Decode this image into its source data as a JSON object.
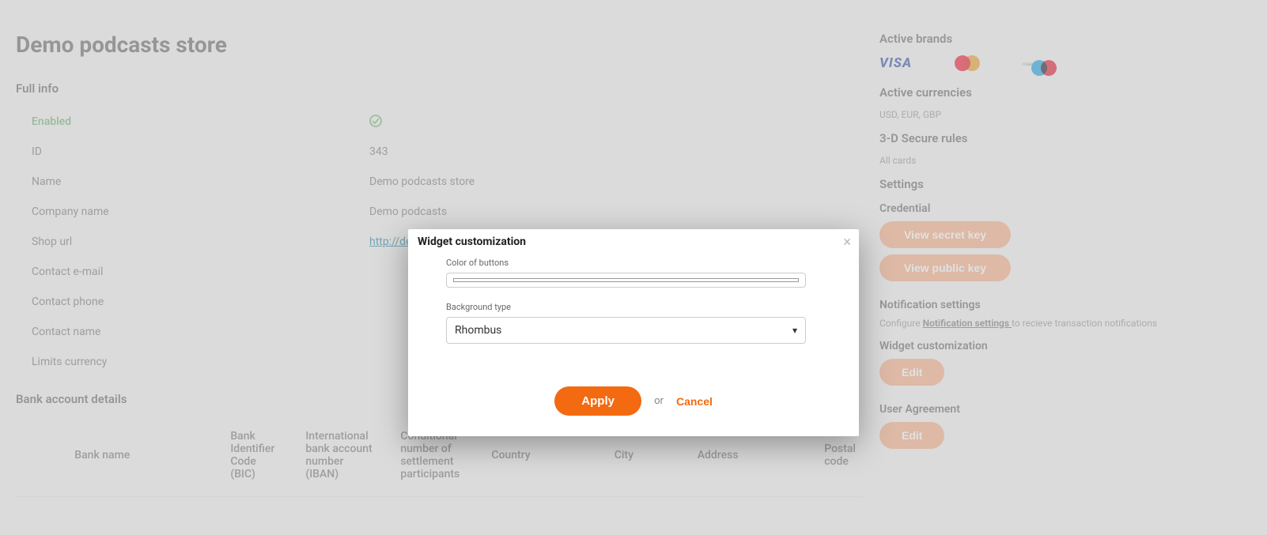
{
  "page_title": "Demo podcasts store",
  "full_info": {
    "heading": "Full info",
    "rows": {
      "enabled": {
        "label": "Enabled"
      },
      "id": {
        "label": "ID",
        "value": "343"
      },
      "name": {
        "label": "Name",
        "value": "Demo podcasts store"
      },
      "company": {
        "label": "Company name",
        "value": "Demo podcasts"
      },
      "shop_url": {
        "label": "Shop url",
        "value": "http://demopodcastsstore.com"
      },
      "contact_email": {
        "label": "Contact e-mail",
        "value": ""
      },
      "contact_phone": {
        "label": "Contact phone",
        "value": ""
      },
      "contact_name": {
        "label": "Contact name",
        "value": ""
      },
      "limits_currency": {
        "label": "Limits currency",
        "value": ""
      }
    }
  },
  "bank": {
    "heading": "Bank account details",
    "columns": [
      "Bank name",
      "Bank Identifier Code (BIC)",
      "International bank account number (IBAN)",
      "Conditional number of settlement participants",
      "Country",
      "City",
      "Address",
      "Postal code"
    ]
  },
  "side": {
    "active_brands": {
      "heading": "Active brands"
    },
    "active_currencies": {
      "heading": "Active currencies",
      "value": "USD, EUR, GBP"
    },
    "secure_rules": {
      "heading": "3-D Secure rules",
      "value": "All cards"
    },
    "settings": {
      "heading": "Settings"
    },
    "credential": {
      "heading": "Credential",
      "view_secret": "View secret key",
      "view_public": "View public key"
    },
    "notification": {
      "heading": "Notification settings",
      "pre": "Configure ",
      "link": "Notification settings ",
      "post": "to recieve transaction notifications"
    },
    "widget": {
      "heading": "Widget customization",
      "edit": "Edit"
    },
    "user_agreement": {
      "heading": "User Agreement",
      "edit": "Edit"
    }
  },
  "modal": {
    "title": "Widget customization",
    "color_label": "Color of buttons",
    "bg_label": "Background type",
    "bg_value": "Rhombus",
    "apply": "Apply",
    "or": "or",
    "cancel": "Cancel"
  }
}
